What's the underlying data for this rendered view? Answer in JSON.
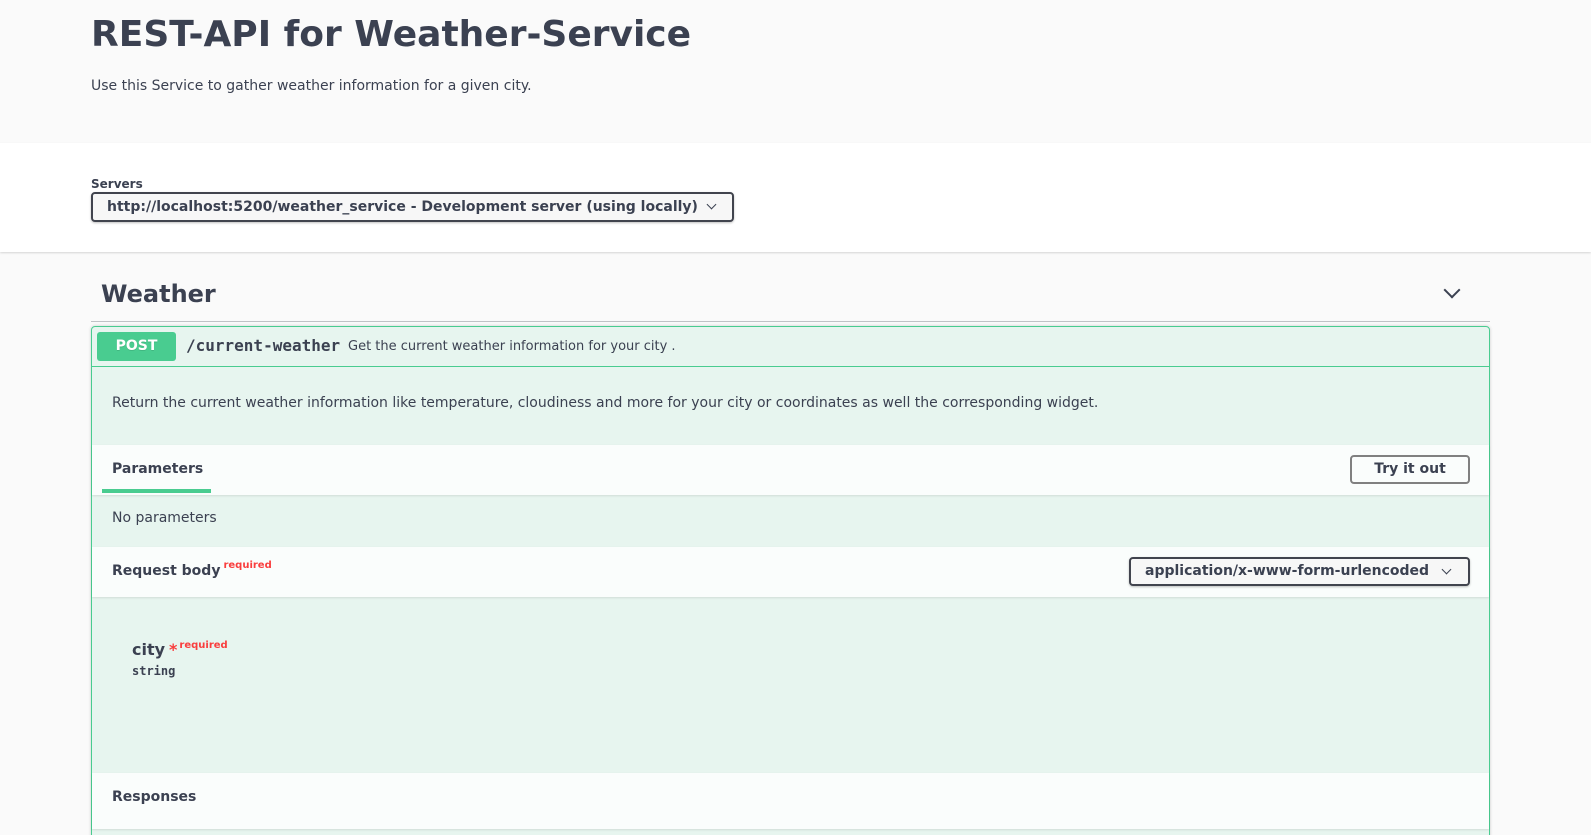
{
  "info": {
    "title": "REST-API for Weather-Service",
    "description": "Use this Service to gather weather information for a given city."
  },
  "servers": {
    "label": "Servers",
    "selected": "http://localhost:5200/weather_service - Development server (using locally)"
  },
  "tag": {
    "name": "Weather"
  },
  "operation": {
    "method": "POST",
    "path": "/current-weather",
    "summary": "Get the current weather information for your city .",
    "description": "Return the current weather information like temperature, cloudiness and more for your city or coordinates as well the corresponding widget.",
    "parameters_tab": "Parameters",
    "try_it_out": "Try it out",
    "no_parameters": "No parameters",
    "request_body": {
      "label": "Request body",
      "required": "required",
      "content_type": "application/x-www-form-urlencoded",
      "params": [
        {
          "name": "city",
          "star": "*",
          "required": "required",
          "type": "string"
        }
      ]
    },
    "responses_label": "Responses"
  },
  "colors": {
    "post_green": "#49cc90",
    "required_red": "#f93e3e",
    "text": "#3b4151"
  }
}
